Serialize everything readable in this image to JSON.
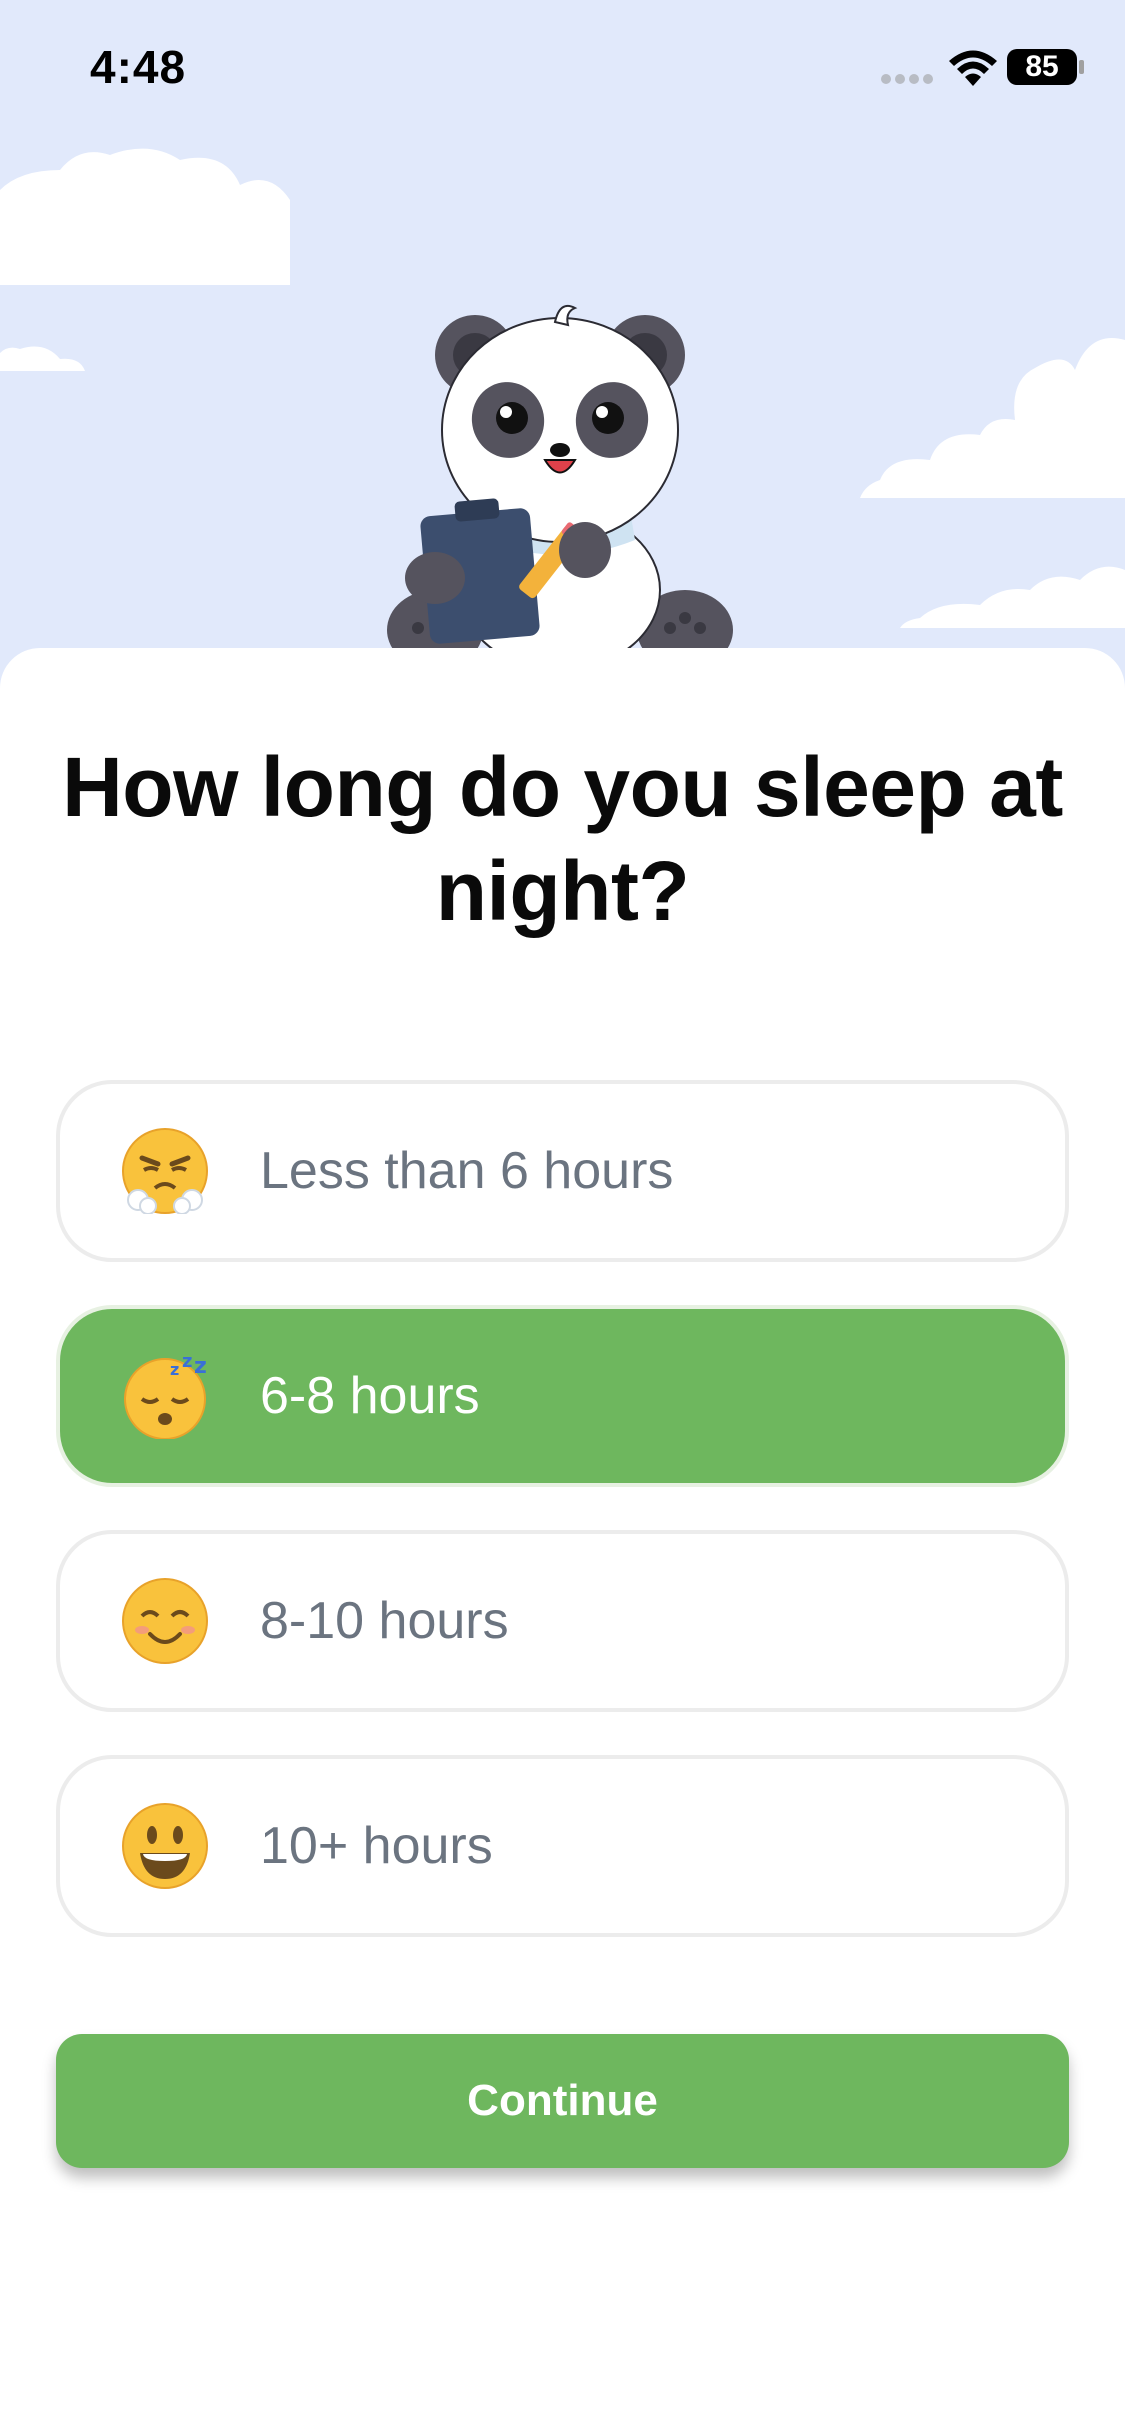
{
  "status_bar": {
    "time": "4:48",
    "battery": "85",
    "icons": [
      "cellular-signal-icon",
      "wifi-icon",
      "battery-icon"
    ]
  },
  "header": {
    "illustration": "panda-with-clipboard-icon"
  },
  "question": {
    "title": "How long do you sleep at night?"
  },
  "options": [
    {
      "label": "Less than 6 hours",
      "emoji": "steam-face-icon",
      "selected": false
    },
    {
      "label": "6-8 hours",
      "emoji": "sleeping-face-icon",
      "selected": true
    },
    {
      "label": "8-10 hours",
      "emoji": "smiling-face-icon",
      "selected": false
    },
    {
      "label": "10+ hours",
      "emoji": "grinning-face-icon",
      "selected": false
    }
  ],
  "continue_label": "Continue",
  "colors": {
    "accent_green": "#6eb75e",
    "sky": "#e1e9fb",
    "option_text": "#6b7480",
    "option_border": "#ececec"
  }
}
